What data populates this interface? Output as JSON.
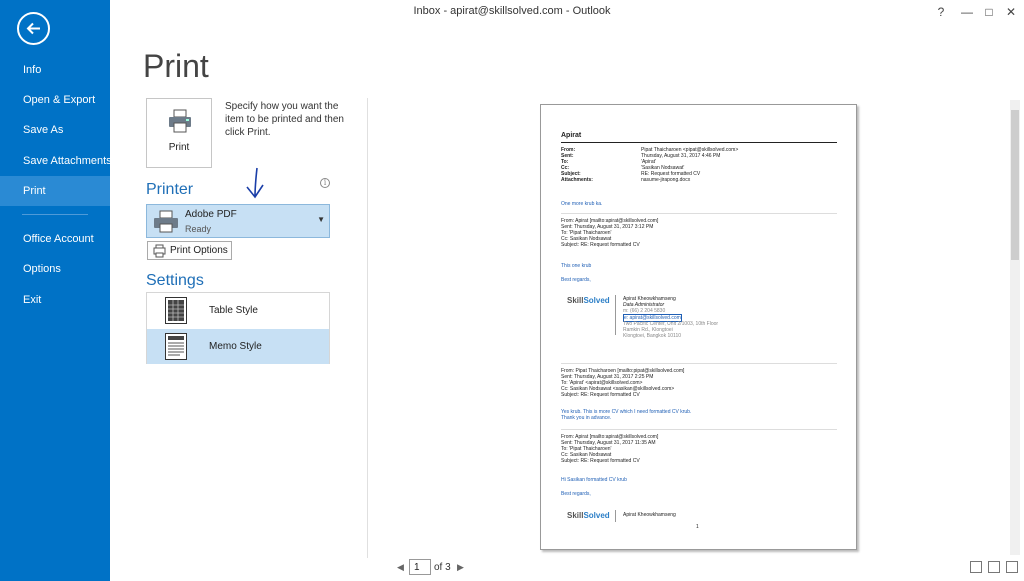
{
  "window": {
    "title": "Inbox - apirat@skillsolved.com - Outlook",
    "help": "?",
    "minimize": "—",
    "maximize": "□",
    "close": "✕"
  },
  "sidebar": {
    "items": [
      "Info",
      "Open & Export",
      "Save As",
      "Save Attachments",
      "Print",
      "Office Account",
      "Options",
      "Exit"
    ],
    "active": "Print"
  },
  "print": {
    "title": "Print",
    "button_label": "Print",
    "description": "Specify how you want the item to be printed and then click Print."
  },
  "printer": {
    "section_title": "Printer",
    "info_glyph": "i",
    "name": "Adobe PDF",
    "status": "Ready",
    "options_label": "Print Options"
  },
  "settings": {
    "section_title": "Settings",
    "styles": [
      "Table Style",
      "Memo Style"
    ],
    "selected": "Memo Style"
  },
  "preview": {
    "sender": "Apirat",
    "header_labels": [
      "From:",
      "Sent:",
      "To:",
      "Cc:",
      "Subject:",
      "Attachments:"
    ],
    "header_values": [
      "Pipat Thaicharoen <pipat@skillsolved.com>",
      "Thursday, August 31, 2017 4:46 PM",
      "'Apirat'",
      "'Sasikan Nodsawat'",
      "RE: Request formatted CV",
      "nasume-jirapong.docx"
    ],
    "body1": "One more krub ka.",
    "q1": [
      "From: Apirat [mailto:apirat@skillsolved.com]",
      "Sent: Thursday, August 31, 2017 3:12 PM",
      "To: 'Pipat Thaicharoen'",
      "Cc: Sasikan Nodsawat",
      "Subject: RE: Request formatted CV"
    ],
    "body2": "This one krub",
    "regards": "Best regards,",
    "logo_a": "Skill",
    "logo_b": "Solved",
    "sig": [
      "Apirat Kheowkhamseng",
      "Data Administrator",
      "m: (66) 2 204 5830",
      "e: apirat@skillsolved.com",
      "Two Pacific Center, Unit 2/1003, 10th Floor",
      "Ramkin Rd., Klongtoei",
      "Klongtoei, Bangkok 10110"
    ],
    "q2": [
      "From: Pipat Thaicharoen [mailto:pipat@skillsolved.com]",
      "Sent: Thursday, August 31, 2017 2:25 PM",
      "To: 'Apirat' <apirat@skillsolved.com>",
      "Cc: Sasikan Nodsawat <sasikan@skillsolved.com>",
      "Subject: RE: Request formatted CV"
    ],
    "body3": [
      "Yes krub. This is more CV which I need formatted CV krub.",
      "Thank you in advance."
    ],
    "q3": [
      "From: Apirat [mailto:apirat@skillsolved.com]",
      "Sent: Thursday, August 31, 2017 11:35 AM",
      "To: 'Pipat Thaicharoen'",
      "Cc: Sasikan Nodsawat",
      "Subject: RE: Request formatted CV"
    ],
    "body4": "Hi Sasikan formatted CV krub",
    "sig2": "Apirat Kheowkhamseng",
    "page_no": "1"
  },
  "pager": {
    "current": "1",
    "of": "of 3",
    "prev": "◀",
    "next": "▶"
  },
  "colors": {
    "sidebar": "#0072c6",
    "accent": "#1f6fb7",
    "selected": "#c7e0f4"
  }
}
